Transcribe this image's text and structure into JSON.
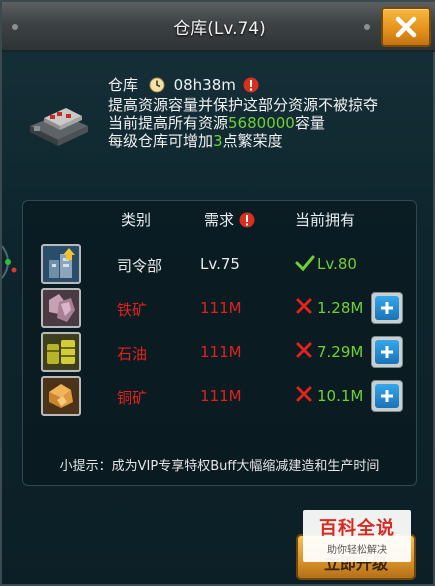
{
  "window": {
    "title": "仓库(Lv.74)"
  },
  "close_button": {
    "icon": "close-x-icon",
    "color": "#e2901a"
  },
  "building": {
    "name": "仓库",
    "timer": "08h38m",
    "desc1": "提高资源容量并保护这部分资源不被掠夺",
    "desc2_prefix": "当前提高所有资源",
    "desc2_value": "5680000",
    "desc2_suffix": "容量",
    "desc3_prefix": "每级仓库可增加",
    "desc3_value": "3",
    "desc3_suffix": "点繁荣度"
  },
  "table": {
    "headers": {
      "category": "类别",
      "required": "需求",
      "owned": "当前拥有"
    },
    "rows": [
      {
        "icon": "command-center-icon",
        "category": "司令部",
        "required": "Lv.75",
        "owned": "Lv.80",
        "met": true,
        "color": "#eaeaea"
      },
      {
        "icon": "iron-ore-icon",
        "category": "铁矿",
        "required": "111M",
        "owned": "1.28M",
        "met": false,
        "color": "#e0221d"
      },
      {
        "icon": "oil-barrel-icon",
        "category": "石油",
        "required": "111M",
        "owned": "7.29M",
        "met": false,
        "color": "#e0221d"
      },
      {
        "icon": "copper-ore-icon",
        "category": "铜矿",
        "required": "111M",
        "owned": "10.1M",
        "met": false,
        "color": "#e0221d"
      }
    ],
    "tip": "小提示：成为VIP专享特权Buff大幅缩减建造和生产时间"
  },
  "bottom_button": {
    "label": "立即升级"
  },
  "watermark": {
    "title": "百科全说",
    "subtitle": "助你轻松解决"
  },
  "colors": {
    "accent_green": "#6fd136",
    "warning_red": "#e0221d",
    "plus_blue": "#1a73b8"
  }
}
